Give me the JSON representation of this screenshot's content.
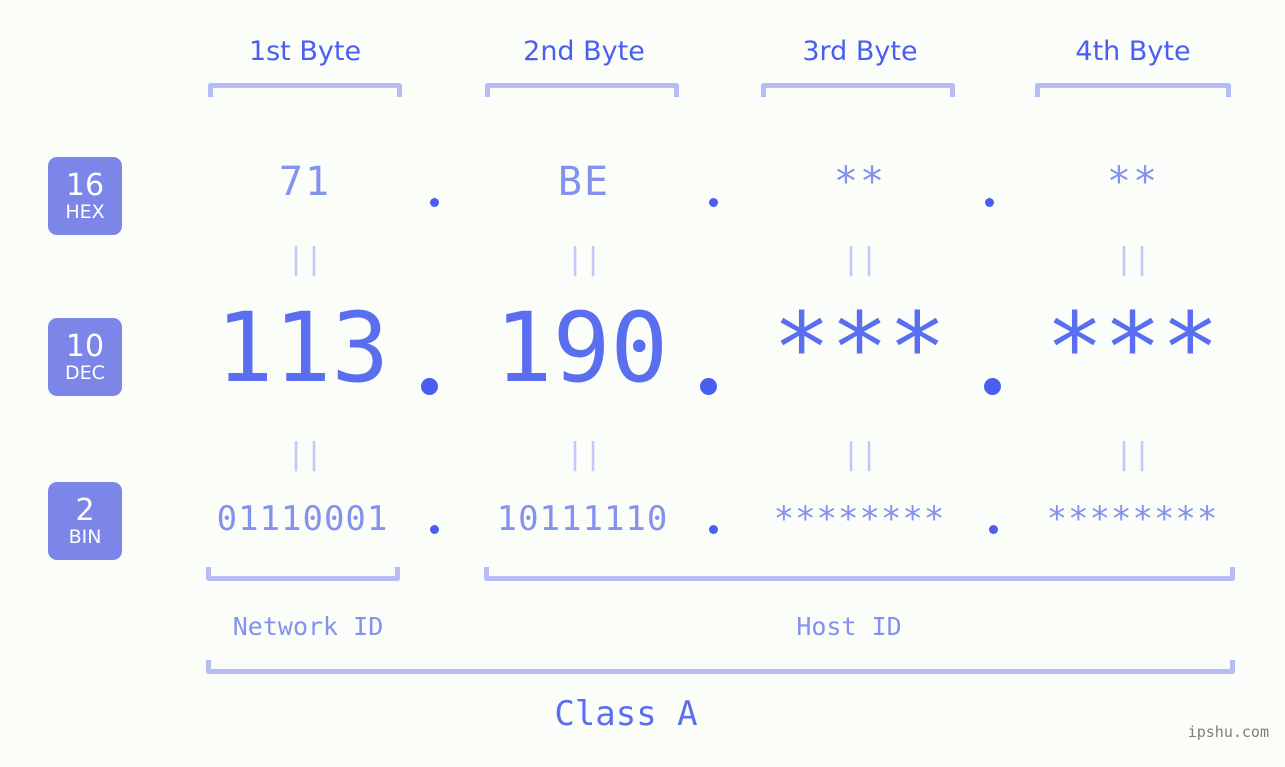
{
  "meta": {
    "background_color": "#fbfdf9",
    "accent_color": "#4a5ef0",
    "badge_color": "#7b86e8",
    "bracket_color": "#b6bdf5",
    "value_color": "#8491ee",
    "dec_color": "#5a6ef0"
  },
  "byte_headers": [
    {
      "label": "1st Byte"
    },
    {
      "label": "2nd Byte"
    },
    {
      "label": "3rd Byte"
    },
    {
      "label": "4th Byte"
    }
  ],
  "rows": [
    {
      "badge_number": "16",
      "badge_label": "HEX",
      "values": [
        "71",
        "BE",
        "**",
        "**"
      ],
      "separators": [
        ".",
        ".",
        "."
      ]
    },
    {
      "badge_number": "10",
      "badge_label": "DEC",
      "values": [
        "113",
        "190",
        "***",
        "***"
      ],
      "separators": [
        ".",
        ".",
        "."
      ]
    },
    {
      "badge_number": "2",
      "badge_label": "BIN",
      "values": [
        "01110001",
        "10111110",
        "********",
        "********"
      ],
      "separators": [
        ".",
        ".",
        "."
      ]
    }
  ],
  "equality_separators": {
    "glyph": "||",
    "count_per_gap": 4
  },
  "regions": [
    {
      "label": "Network ID"
    },
    {
      "label": "Host ID"
    }
  ],
  "class_label": "Class A",
  "watermark": "ipshu.com"
}
